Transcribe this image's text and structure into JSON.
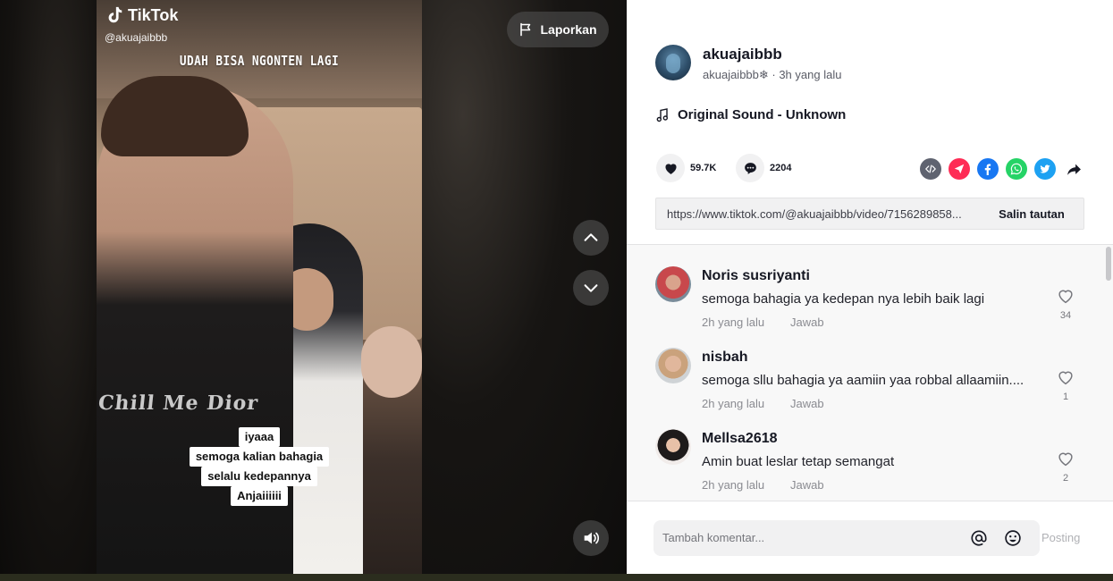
{
  "video": {
    "platform_wordmark": "TikTok",
    "handle": "@akuajaibbb",
    "overlay_title": "UDAH BISA NGONTEN LAGI",
    "shirt_print": "Chill Me Dior",
    "captions": [
      "iyaaa",
      "semoga kalian bahagia",
      "selalu kedepannya",
      "Anjaiiiiii"
    ],
    "report_label": "Laporkan"
  },
  "author": {
    "name": "akuajaibbb",
    "meta": "akuajaibbb❄ · 3h yang lalu"
  },
  "sound": {
    "label": "Original Sound - Unknown"
  },
  "stats": {
    "likes": "59.7K",
    "comments": "2204"
  },
  "link": {
    "url": "https://www.tiktok.com/@akuajaibbb/video/7156289858...",
    "copy_label": "Salin tautan"
  },
  "comments": [
    {
      "user": "Noris susriyanti",
      "text": "semoga bahagia ya kedepan nya lebih baik lagi",
      "time": "2h yang lalu",
      "reply": "Jawab",
      "likes": "34"
    },
    {
      "user": "nisbah",
      "text": "semoga sllu bahagia ya aamiin yaa robbal allaamiin....",
      "time": "2h yang lalu",
      "reply": "Jawab",
      "likes": "1"
    },
    {
      "user": "Mellsa2618",
      "text": "Amin buat leslar tetap semangat",
      "time": "2h yang lalu",
      "reply": "Jawab",
      "likes": "2"
    }
  ],
  "composer": {
    "placeholder": "Tambah komentar...",
    "post_label": "Posting"
  },
  "icons": {
    "tiktok": "tiktok-logo-icon",
    "report": "flag-icon",
    "up": "chevron-up-icon",
    "down": "chevron-down-icon",
    "volume": "speaker-icon",
    "like": "heart-icon",
    "comment": "comment-bubble-icon",
    "music": "music-note-icon"
  },
  "colors": {
    "accent": "#fe2c55",
    "facebook": "#1877f2",
    "whatsapp": "#25d366",
    "twitter": "#1da1f2"
  }
}
